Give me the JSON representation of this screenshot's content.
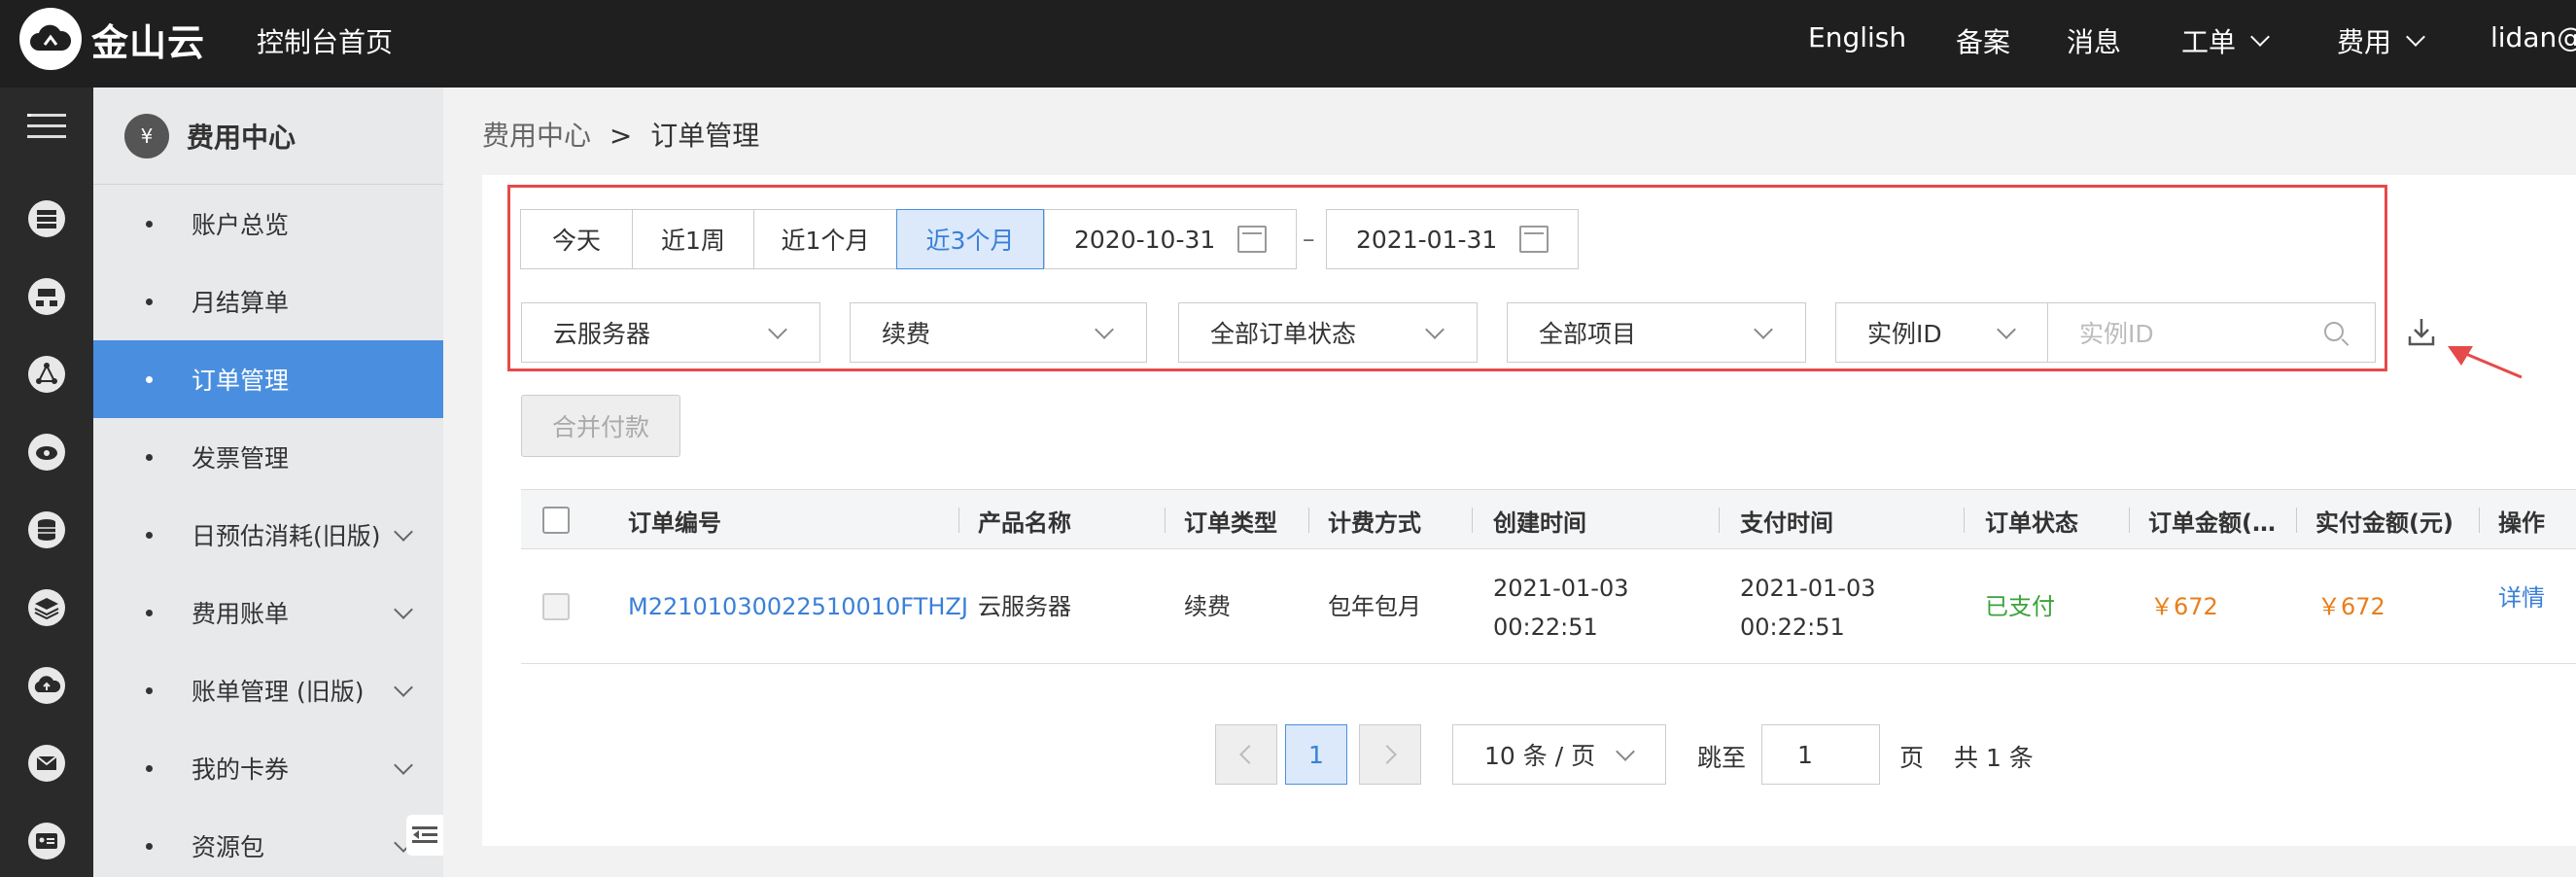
{
  "topbar": {
    "brand": "金山云",
    "console_home": "控制台首页",
    "nav": {
      "english": "English",
      "filing": "备案",
      "messages": "消息",
      "tickets": "工单",
      "billing": "费用",
      "user": "lidan@"
    }
  },
  "rail": {
    "icons": [
      "menu-icon",
      "server-icon",
      "network-icon",
      "share-icon",
      "cloud-disk-icon",
      "database-icon",
      "layers-icon",
      "cloud-upload-icon",
      "mail-icon",
      "id-card-icon"
    ]
  },
  "sidebar": {
    "title": "费用中心",
    "title_icon": "¥",
    "items": [
      {
        "label": "账户总览"
      },
      {
        "label": "月结算单"
      },
      {
        "label": "订单管理",
        "active": true
      },
      {
        "label": "发票管理"
      },
      {
        "label": "日预估消耗(旧版)",
        "expandable": true
      },
      {
        "label": "费用账单",
        "expandable": true
      },
      {
        "label": "账单管理 (旧版)",
        "expandable": true
      },
      {
        "label": "我的卡券",
        "expandable": true
      },
      {
        "label": "资源包",
        "expandable": true
      }
    ]
  },
  "breadcrumb": {
    "parent": "费用中心",
    "separator": ">",
    "current": "订单管理"
  },
  "filters": {
    "ranges": [
      {
        "label": "今天"
      },
      {
        "label": "近1周"
      },
      {
        "label": "近1个月"
      },
      {
        "label": "近3个月",
        "active": true
      }
    ],
    "start_date": "2020-10-31",
    "date_separator": "–",
    "end_date": "2021-01-31",
    "product": "云服务器",
    "order_type": "续费",
    "order_status": "全部订单状态",
    "project": "全部项目",
    "search_field": "实例ID",
    "search_placeholder": "实例ID"
  },
  "actions": {
    "merge_pay": "合并付款"
  },
  "table": {
    "headers": [
      "订单编号",
      "产品名称",
      "订单类型",
      "计费方式",
      "创建时间",
      "支付时间",
      "订单状态",
      "订单金额(…",
      "实付金额(元)",
      "操作"
    ],
    "rows": [
      {
        "order_id": "M22101030022510010FTHZJ",
        "product": "云服务器",
        "type": "续费",
        "billing": "包年包月",
        "created_date": "2021-01-03",
        "created_time": "00:22:51",
        "paid_date": "2021-01-03",
        "paid_time": "00:22:51",
        "status": "已支付",
        "amount": "￥672",
        "paid_amount": "￥672",
        "action": "详情"
      }
    ]
  },
  "pagination": {
    "current_page": "1",
    "page_size": "10 条 / 页",
    "jump_label": "跳至",
    "jump_value": "1",
    "page_unit": "页",
    "total": "共 1 条"
  },
  "colors": {
    "accent": "#4a8fdf",
    "highlight_border": "#e54a4a",
    "paid_green": "#3aa33a",
    "amount_orange": "#e87e1a"
  }
}
